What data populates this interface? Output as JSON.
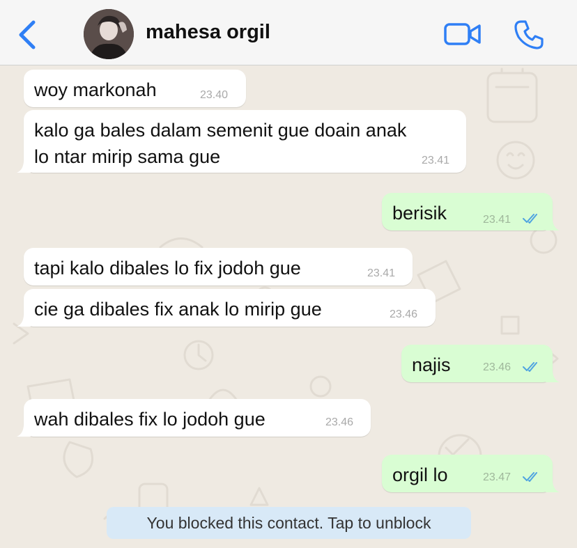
{
  "header": {
    "contact_name": "mahesa orgil",
    "back_icon": "chevron-left-icon",
    "video_icon": "video-camera-icon",
    "call_icon": "phone-icon",
    "accent_color": "#2f7ff5"
  },
  "messages": [
    {
      "direction": "in",
      "text": "woy markonah",
      "time": "23.40"
    },
    {
      "direction": "in",
      "text_lines": [
        "kalo ga bales dalam semenit gue doain anak",
        "lo ntar mirip sama gue"
      ],
      "time": "23.41"
    },
    {
      "direction": "out",
      "text": "berisik",
      "time": "23.41",
      "status": "read"
    },
    {
      "direction": "in",
      "text": "tapi kalo dibales lo fix jodoh gue",
      "time": "23.41"
    },
    {
      "direction": "in",
      "text": "cie ga dibales fix anak lo mirip gue",
      "time": "23.46"
    },
    {
      "direction": "out",
      "text": "najis",
      "time": "23.46",
      "status": "read"
    },
    {
      "direction": "in",
      "text": "wah dibales fix lo jodoh gue",
      "time": "23.46"
    },
    {
      "direction": "out",
      "text": "orgil lo",
      "time": "23.47",
      "status": "read"
    }
  ],
  "blocked_banner": "You blocked this contact. Tap to unblock",
  "colors": {
    "incoming_bubble": "#ffffff",
    "outgoing_bubble": "#d9fdd3",
    "chat_background": "#efeae2",
    "banner": "#d8e9f7",
    "read_ticks": "#4fa3e0"
  }
}
